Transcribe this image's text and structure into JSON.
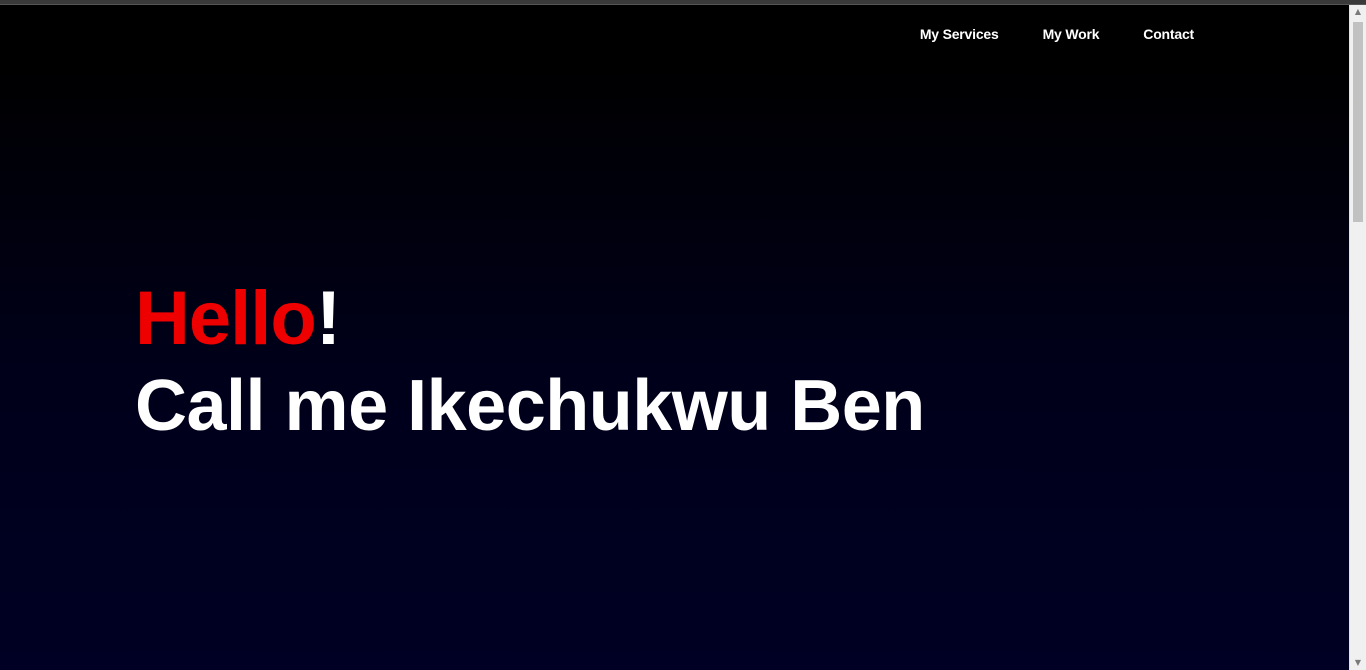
{
  "nav": {
    "items": [
      {
        "label": "My Services"
      },
      {
        "label": "My Work"
      },
      {
        "label": "Contact"
      }
    ]
  },
  "hero": {
    "greeting": "Hello",
    "exclamation": "!",
    "intro": "Call me Ikechukwu Ben"
  },
  "colors": {
    "accent": "#ee0000",
    "text": "#ffffff",
    "background_top": "#000000",
    "background_bottom": "#000024"
  },
  "icons": {
    "scroll_up": "▲",
    "scroll_down": "▼"
  }
}
